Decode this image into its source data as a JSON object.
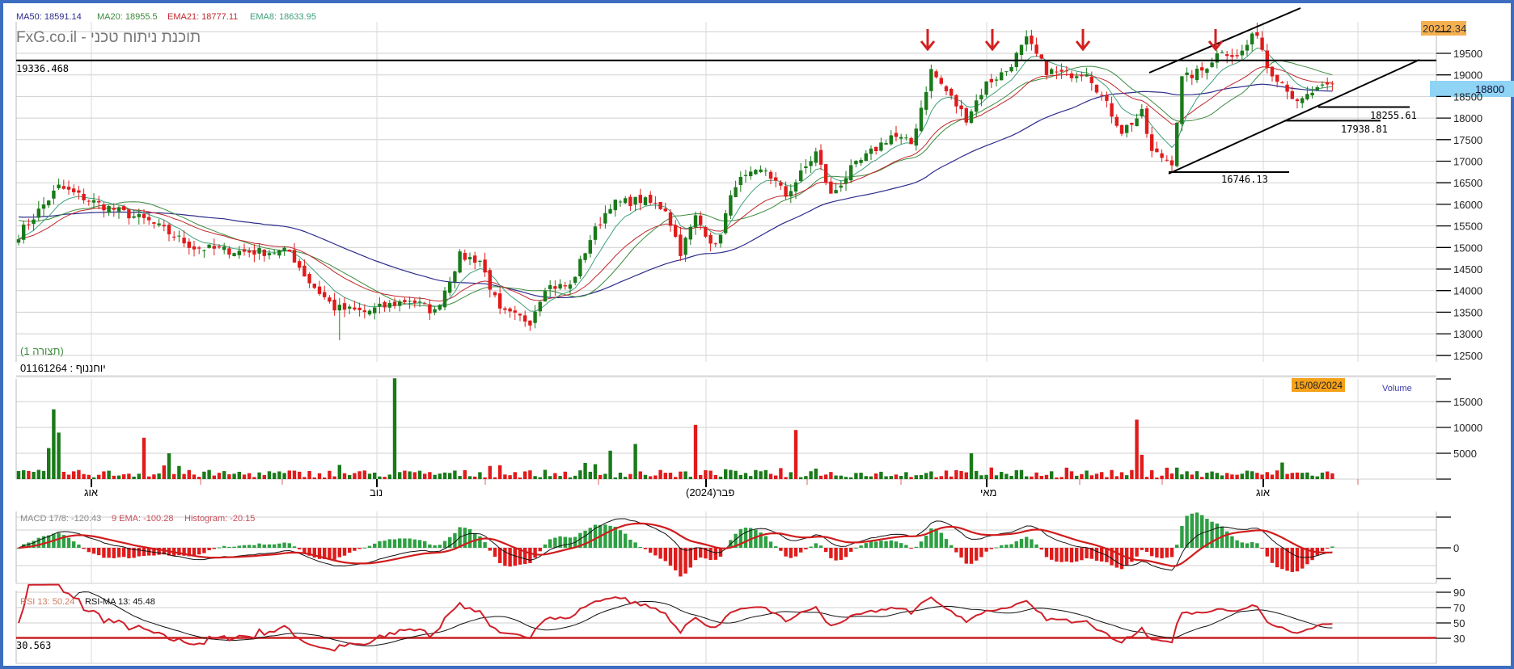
{
  "header": {
    "legend": [
      {
        "label": "MA50: 18591.14",
        "color": "#2c2c8c"
      },
      {
        "label": "MA20: 18955.5",
        "color": "#3d8b3d"
      },
      {
        "label": "EMA21: 18777.11",
        "color": "#c0282d"
      },
      {
        "label": "EMA8: 18633.95",
        "color": "#3fa07a"
      }
    ],
    "brand": "FxG.co.il - תוכנת ניתוח טכני",
    "view_label": "(תצורה 1)",
    "symbol_label": "01161264 : יוחננוף"
  },
  "annotations": {
    "resistance_label": "19336.468",
    "support_labels": [
      "18255.61",
      "17938.81",
      "16746.13"
    ],
    "high_price_box": "20212.34",
    "current_price_box": "18800",
    "date_box": "15/08/2024",
    "volume_label": "Volume",
    "rsi_floor_label": "30.563"
  },
  "indicators": {
    "macd_label": "MACD 17/8: -120.43",
    "macd_signal_label": "9 EMA: -100.28",
    "macd_hist_label": "Histogram: -20.15",
    "rsi_label": "RSI 13: 50.24",
    "rsi_ma_label": "RSI-MA 13: 45.48"
  },
  "colors": {
    "up": "#1a7a1a",
    "down": "#e01b1b",
    "accent": "#f5a623",
    "price_box": "#8fd3f5"
  },
  "chart_data": [
    {
      "type": "candlestick",
      "title": "FxG.co.il - תוכנת ניתוח טכני",
      "ylim": [
        12000,
        20300
      ],
      "y_ticks": [
        "19500",
        "19000",
        "18500",
        "18000",
        "17500",
        "17000",
        "16500",
        "16000",
        "15500",
        "15000",
        "14500",
        "14000",
        "13500",
        "13000",
        "12500"
      ],
      "x_tick_labels": [
        "אוג",
        "נוב",
        "פבר(2024)",
        "מאי",
        "אוג"
      ],
      "close_keypoints": [
        [
          0,
          15300
        ],
        [
          8,
          16400
        ],
        [
          16,
          16000
        ],
        [
          26,
          15600
        ],
        [
          35,
          15000
        ],
        [
          45,
          14900
        ],
        [
          54,
          14900
        ],
        [
          58,
          14200
        ],
        [
          63,
          13600
        ],
        [
          69,
          13500
        ],
        [
          78,
          13800
        ],
        [
          83,
          13500
        ],
        [
          88,
          14800
        ],
        [
          92,
          14700
        ],
        [
          96,
          13500
        ],
        [
          102,
          13300
        ],
        [
          105,
          14100
        ],
        [
          110,
          14100
        ],
        [
          114,
          15200
        ],
        [
          118,
          16000
        ],
        [
          124,
          16100
        ],
        [
          129,
          15900
        ],
        [
          132,
          14900
        ],
        [
          135,
          15700
        ],
        [
          139,
          15000
        ],
        [
          143,
          16500
        ],
        [
          149,
          16800
        ],
        [
          153,
          16200
        ],
        [
          159,
          17200
        ],
        [
          162,
          16200
        ],
        [
          166,
          16800
        ],
        [
          170,
          17200
        ],
        [
          174,
          17600
        ],
        [
          178,
          17400
        ],
        [
          182,
          19100
        ],
        [
          187,
          18300
        ],
        [
          189,
          18000
        ],
        [
          193,
          18800
        ],
        [
          197,
          19100
        ],
        [
          201,
          19800
        ],
        [
          205,
          19100
        ],
        [
          209,
          19000
        ],
        [
          213,
          19100
        ],
        [
          216,
          18500
        ],
        [
          220,
          17700
        ],
        [
          224,
          18100
        ],
        [
          226,
          17200
        ],
        [
          230,
          17000
        ],
        [
          232,
          18900
        ],
        [
          236,
          19100
        ],
        [
          240,
          19600
        ],
        [
          243,
          19400
        ],
        [
          247,
          20000
        ],
        [
          249,
          19200
        ],
        [
          253,
          18700
        ],
        [
          255,
          18300
        ],
        [
          258,
          18600
        ],
        [
          262,
          18750
        ]
      ],
      "resistance": 19336.468,
      "supports": [
        18255.61,
        17938.81,
        16746.13
      ],
      "last_close": 18800,
      "high": 20212.34
    },
    {
      "type": "bar",
      "title": "Volume",
      "ylim": [
        0,
        20000
      ],
      "y_ticks": [
        "15000",
        "10000",
        "5000"
      ],
      "spikes": [
        [
          7,
          13500,
          "up"
        ],
        [
          8,
          9000,
          "up"
        ],
        [
          6,
          6000,
          "up"
        ],
        [
          25,
          8000,
          "down"
        ],
        [
          30,
          5000,
          "up"
        ],
        [
          75,
          19500,
          "up"
        ],
        [
          118,
          5500,
          "up"
        ],
        [
          123,
          6800,
          "up"
        ],
        [
          135,
          10500,
          "down"
        ],
        [
          155,
          9500,
          "down"
        ],
        [
          190,
          5000,
          "up"
        ],
        [
          223,
          11500,
          "down"
        ],
        [
          224,
          4700,
          "down"
        ],
        [
          252,
          3200,
          "up"
        ]
      ]
    },
    {
      "type": "line",
      "title": "MACD 17/8",
      "y_ticks": [
        "0"
      ],
      "macd": -120.43,
      "signal": -100.28,
      "histogram": -20.15
    },
    {
      "type": "line",
      "title": "RSI 13",
      "ylim": [
        20,
        95
      ],
      "y_ticks": [
        "90",
        "70",
        "50",
        "30"
      ],
      "rsi": 50.24,
      "rsi_ma": 45.48,
      "floor": 30.563
    }
  ]
}
